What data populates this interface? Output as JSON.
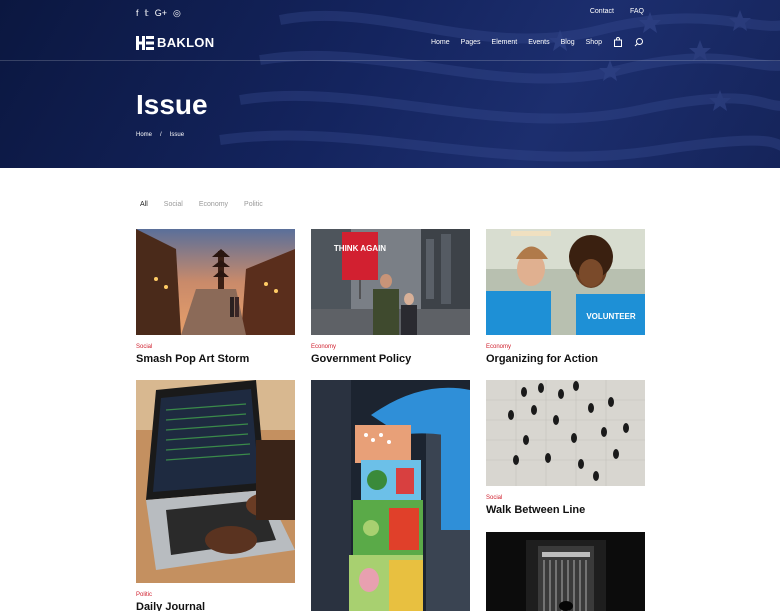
{
  "colors": {
    "accent": "#d0212f",
    "hero_bg": "#14245e"
  },
  "social": [
    {
      "name": "facebook-icon",
      "glyph": "f"
    },
    {
      "name": "twitter-icon",
      "glyph": "𝕥"
    },
    {
      "name": "google-plus-icon",
      "glyph": "G+"
    },
    {
      "name": "instagram-icon",
      "glyph": "◎"
    }
  ],
  "toplinks": {
    "contact": "Contact",
    "faq": "FAQ"
  },
  "logo": {
    "text": "BAKLON"
  },
  "nav": {
    "home": "Home",
    "pages": "Pages",
    "element": "Element",
    "events": "Events",
    "blog": "Blog",
    "shop": "Shop"
  },
  "page": {
    "title": "Issue"
  },
  "breadcrumb": {
    "home": "Home",
    "separator": "/",
    "current": "Issue"
  },
  "filters": {
    "all": "All",
    "social": "Social",
    "economy": "Economy",
    "politic": "Politic"
  },
  "cards": [
    {
      "category": "Social",
      "title": "Smash Pop Art Storm",
      "image": "street-pagoda-photo"
    },
    {
      "category": "Economy",
      "title": "Government Policy",
      "image": "protest-sign-photo",
      "sign_text": "THINK AGAIN"
    },
    {
      "category": "Economy",
      "title": "Organizing for Action",
      "image": "volunteers-selfie-photo",
      "shirt_text": "VOLUNTEER"
    },
    {
      "category": "Politic",
      "title": "Daily Journal",
      "image": "laptop-typing-photo"
    },
    {
      "category": "",
      "title": "",
      "image": "toy-blocks-photo"
    },
    {
      "category": "Social",
      "title": "Walk Between Line",
      "image": "crowd-aerial-photo"
    },
    {
      "category": "",
      "title": "",
      "image": "dark-hall-photo"
    }
  ]
}
